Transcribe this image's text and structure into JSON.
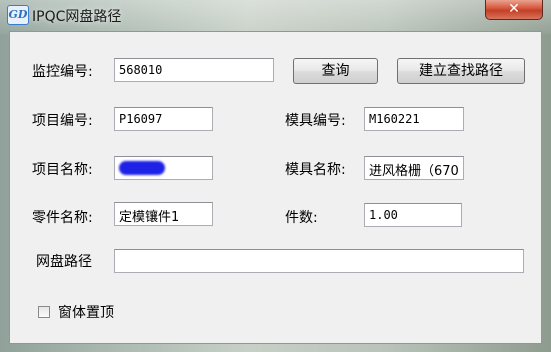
{
  "window": {
    "title": "IPQC网盘路径",
    "icon_text": "GD",
    "close_glyph": "✕"
  },
  "form": {
    "monitor_no_label": "监控编号:",
    "monitor_no_value": "568010",
    "query_button": "查询",
    "build_path_button": "建立查找路径",
    "project_no_label": "项目编号:",
    "project_no_value": "P16097",
    "mold_no_label": "模具编号:",
    "mold_no_value": "M160221",
    "project_name_label": "项目名称:",
    "project_name_value": "",
    "mold_name_label": "模具名称:",
    "mold_name_value": "进风格栅（670",
    "part_name_label": "零件名称:",
    "part_name_value": "定模镶件1",
    "quantity_label": "件数:",
    "quantity_value": "1.00",
    "net_path_label": "网盘路径",
    "net_path_value": "",
    "topmost_label": "窗体置顶",
    "topmost_checked": false
  }
}
